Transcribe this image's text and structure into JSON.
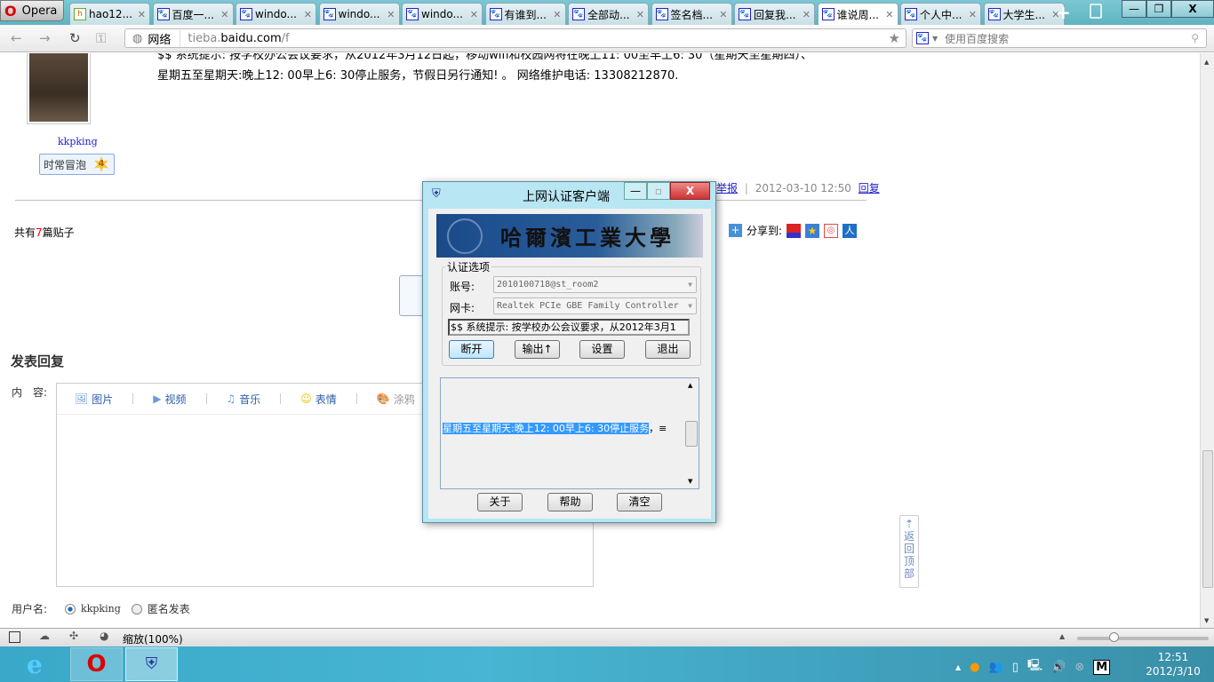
{
  "browser": {
    "menu_label": "Opera",
    "tabs": [
      {
        "label": "hao12...",
        "icon": "hao123-icon"
      },
      {
        "label": "百度一...",
        "icon": "baidu-paw-icon"
      },
      {
        "label": "windo...",
        "icon": "baidu-paw-icon"
      },
      {
        "label": "windo...",
        "icon": "baidu-paw-icon"
      },
      {
        "label": "windo...",
        "icon": "baidu-paw-icon"
      },
      {
        "label": "有谁到...",
        "icon": "baidu-paw-icon"
      },
      {
        "label": "全部动...",
        "icon": "baidu-paw-icon"
      },
      {
        "label": "签名档...",
        "icon": "baidu-paw-icon"
      },
      {
        "label": "回复我...",
        "icon": "baidu-paw-icon"
      },
      {
        "label": "谁说周...",
        "icon": "baidu-paw-icon",
        "active": true
      },
      {
        "label": "个人中...",
        "icon": "baidu-paw-icon"
      },
      {
        "label": "大学生...",
        "icon": "baidu-paw-icon"
      }
    ],
    "address": {
      "zone": "网络",
      "url_prefix": "tieba.",
      "url_domain": "baidu.com",
      "url_path": "/f"
    },
    "search_placeholder": "使用百度搜索",
    "status": {
      "zoom_label": "缩放(100%)",
      "zoom_level_fraction": 0.28
    }
  },
  "post": {
    "body_line1": "$$ 系统提示: 按学校办公会议要求，从2012年3月12日起，移动wifi和校园网将在晚上11: 00至早上6: 30（星期天至星期四）、",
    "body_line2": "星期五至星期天:晚上12: 00早上6: 30停止服务，节假日另行通知! 。 网络维护电话: 13308212870.",
    "username": "kkpking",
    "badge_label": "时常冒泡",
    "badge_level": "4",
    "report_label": "举报",
    "timestamp": "2012-03-10 12:50",
    "reply_label": "回复"
  },
  "thread": {
    "count_prefix": "共有",
    "count": "7",
    "count_suffix": "篇贴子",
    "share_label": "分享到:"
  },
  "reply_form": {
    "title": "发表回复",
    "content_label": "内　容:",
    "toolbar": [
      {
        "label": "图片",
        "icon": "image-icon"
      },
      {
        "label": "视频",
        "icon": "video-icon"
      },
      {
        "label": "音乐",
        "icon": "music-icon"
      },
      {
        "label": "表情",
        "icon": "smiley-icon"
      },
      {
        "label": "涂鸦",
        "icon": "palette-icon"
      }
    ],
    "username_label": "用户名:",
    "user_option": "kkpking",
    "anon_option": "匿名发表"
  },
  "back_to_top": "返回顶部",
  "dialog": {
    "title": "上网认证客户端",
    "banner_text": "哈爾濱工業大學",
    "group_label": "认证选项",
    "account_label": "账号:",
    "account_value": "2010100718@st_room2",
    "nic_label": "网卡:",
    "nic_value": "Realtek PCIe GBE Family Controller",
    "notice": "$$ 系统提示: 按学校办公会议要求，从2012年3月1",
    "buttons": {
      "disconnect": "断开",
      "output": "输出↑",
      "settings": "设置",
      "exit": "退出",
      "about": "关于",
      "help": "帮助",
      "clear": "清空"
    },
    "log_selected": "星期五至星期天:晚上12: 00早上6: 30停止服务",
    "log_rest": "，≡"
  },
  "taskbar": {
    "time": "12:51",
    "date": "2012/3/10",
    "ime": "M"
  }
}
